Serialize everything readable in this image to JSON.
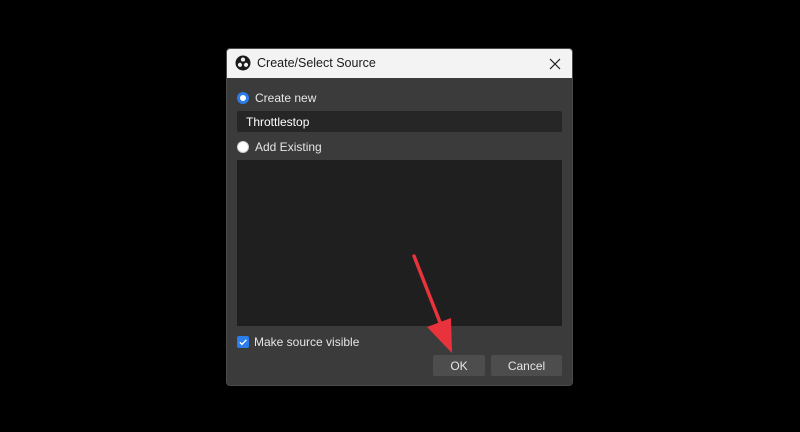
{
  "dialog": {
    "title": "Create/Select Source",
    "app_icon": "obs-logo-icon",
    "close_icon": "close-icon"
  },
  "create_new": {
    "label": "Create new",
    "selected": true,
    "name_value": "Throttlestop"
  },
  "add_existing": {
    "label": "Add Existing",
    "selected": false
  },
  "make_visible": {
    "label": "Make source visible",
    "checked": true
  },
  "buttons": {
    "ok_label": "OK",
    "cancel_label": "Cancel"
  },
  "annotation": {
    "arrow_icon": "red-arrow-pointer",
    "arrow_color": "#e8333c"
  },
  "colors": {
    "accent": "#2b7de9"
  }
}
